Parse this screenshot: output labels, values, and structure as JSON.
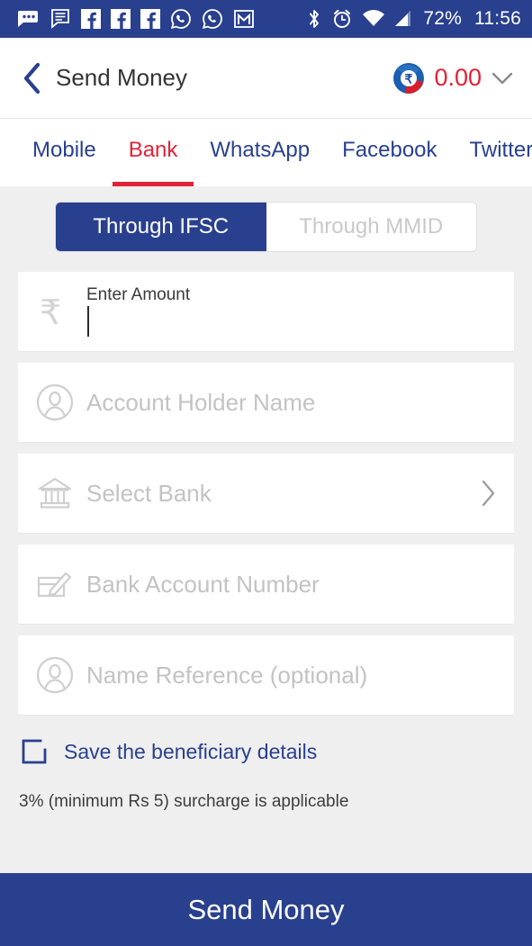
{
  "statusbar": {
    "icons_left": [
      "messages-icon",
      "notes-icon",
      "facebook-icon",
      "facebook-icon",
      "facebook-icon",
      "whatsapp-icon",
      "whatsapp-icon",
      "gmail-icon"
    ],
    "icons_right": [
      "bluetooth-icon",
      "alarm-icon",
      "wifi-icon",
      "signal-icon"
    ],
    "battery": "72%",
    "time": "11:56"
  },
  "header": {
    "back": "back-chevron-icon",
    "title": "Send Money",
    "wallet_icon": "wallet-rupee-icon",
    "wallet_amount": "0.00",
    "wallet_chevron": "chevron-down-icon"
  },
  "tabs": {
    "active_index": 1,
    "items": [
      {
        "label": "Mobile"
      },
      {
        "label": "Bank"
      },
      {
        "label": "WhatsApp"
      },
      {
        "label": "Facebook"
      },
      {
        "label": "Twitter"
      }
    ]
  },
  "segmented": {
    "active_index": 0,
    "options": [
      {
        "label": "Through IFSC"
      },
      {
        "label": "Through MMID"
      }
    ]
  },
  "form": {
    "amount": {
      "icon": "rupee-icon",
      "label": "Enter Amount",
      "value": ""
    },
    "fields": [
      {
        "icon": "person-circle-icon",
        "placeholder": "Account Holder Name",
        "value": "",
        "chevron": false
      },
      {
        "icon": "bank-building-icon",
        "placeholder": "Select Bank",
        "value": "",
        "chevron": true
      },
      {
        "icon": "cheque-pen-icon",
        "placeholder": "Bank Account Number",
        "value": "",
        "chevron": false
      },
      {
        "icon": "person-circle-icon",
        "placeholder": "Name Reference (optional)",
        "value": "",
        "chevron": false
      }
    ],
    "save_beneficiary": {
      "icon": "checkbox-unchecked-icon",
      "label": "Save the beneficiary details",
      "checked": false
    },
    "surcharge_note": "3% (minimum Rs 5) surcharge is applicable"
  },
  "cta": {
    "label": "Send Money"
  },
  "colors": {
    "brand_blue": "#29408f",
    "accent_red": "#e32236",
    "page_bg": "#efefef",
    "card_bg": "#ffffff",
    "placeholder_grey": "#c3c3c3"
  }
}
